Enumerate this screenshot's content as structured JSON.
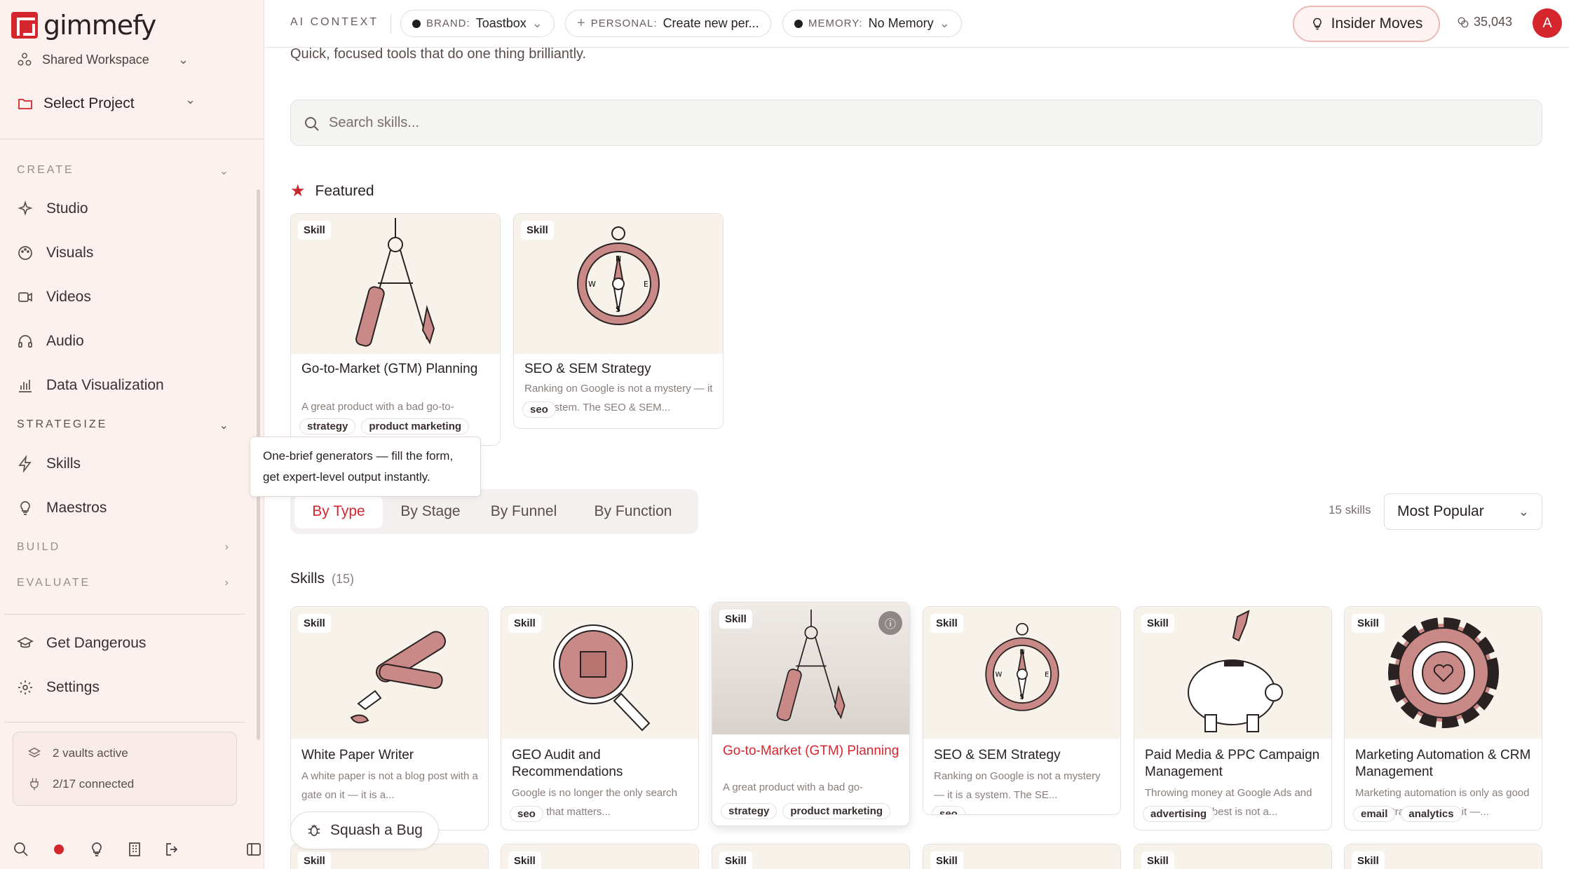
{
  "app": {
    "name": "gimmefy"
  },
  "sidebar": {
    "workspace": "Shared Workspace",
    "project": "Select Project",
    "sections": {
      "create": "CREATE",
      "strategize": "STRATEGIZE",
      "build": "BUILD",
      "evaluate": "EVALUATE"
    },
    "create_items": [
      "Studio",
      "Visuals",
      "Videos",
      "Audio",
      "Data Visualization"
    ],
    "strategize_items": [
      "Skills",
      "Maestros"
    ],
    "bottom_items": [
      "Get Dangerous",
      "Settings"
    ],
    "vaults": "2 vaults active",
    "connected": "2/17 connected",
    "tooltip": "One-brief generators — fill the form, get expert-level output instantly."
  },
  "topbar": {
    "ai_context": "AI CONTEXT",
    "brand_key": "BRAND:",
    "brand_val": "Toastbox",
    "personal_key": "PERSONAL:",
    "personal_val": "Create new per...",
    "memory_key": "MEMORY:",
    "memory_val": "No Memory",
    "insider": "Insider Moves",
    "credits": "35,043",
    "avatar": "A"
  },
  "main": {
    "subtitle": "Quick, focused tools that do one thing brilliantly.",
    "search_placeholder": "Search skills...",
    "featured_title": "Featured",
    "featured": [
      {
        "tag": "Skill",
        "title": "Go-to-Market (GTM) Planning",
        "desc": "A great product with a bad go-to-",
        "chips": [
          "strategy",
          "product marketing"
        ]
      },
      {
        "tag": "Skill",
        "title": "SEO & SEM Strategy",
        "desc": "Ranking on Google is not a mystery — it is a system. The SEO & SEM...",
        "chips": [
          "seo"
        ]
      }
    ],
    "tabs": [
      "By Type",
      "By Stage",
      "By Funnel",
      "By Function"
    ],
    "count": "15 skills",
    "sort": "Most Popular",
    "skills_title": "Skills",
    "skills_count": "(15)",
    "skills": [
      {
        "tag": "Skill",
        "title": "White Paper Writer",
        "desc": "A white paper is not a blog post with a gate on it — it is a...",
        "chips": []
      },
      {
        "tag": "Skill",
        "title": "GEO Audit and Recommendations",
        "desc": "Google is no longer the only search engine that matters...",
        "chips": [
          "seo"
        ]
      },
      {
        "tag": "Skill",
        "title": "Go-to-Market (GTM) Planning",
        "desc": "A great product with a bad go-",
        "chips": [
          "strategy",
          "product marketing"
        ]
      },
      {
        "tag": "Skill",
        "title": "SEO & SEM Strategy",
        "desc": "Ranking on Google is not a mystery — it is a system. The SE...",
        "chips": [
          "seo"
        ]
      },
      {
        "tag": "Skill",
        "title": "Paid Media & PPC Campaign Management",
        "desc": "Throwing money at Google Ads and hoping for the best is not a...",
        "chips": [
          "advertising"
        ]
      },
      {
        "tag": "Skill",
        "title": "Marketing Automation & CRM Management",
        "desc": "Marketing automation is only as good as the strategy behind it —...",
        "chips": [
          "email",
          "analytics"
        ]
      }
    ],
    "bottom_tags": [
      "Skill",
      "Skill",
      "Skill",
      "Skill",
      "Skill",
      "Skill"
    ],
    "squash": "Squash a Bug"
  },
  "colors": {
    "accent": "#d6262d",
    "sidebar_bg": "#fdf1ef",
    "illustration": "#c98a87"
  }
}
